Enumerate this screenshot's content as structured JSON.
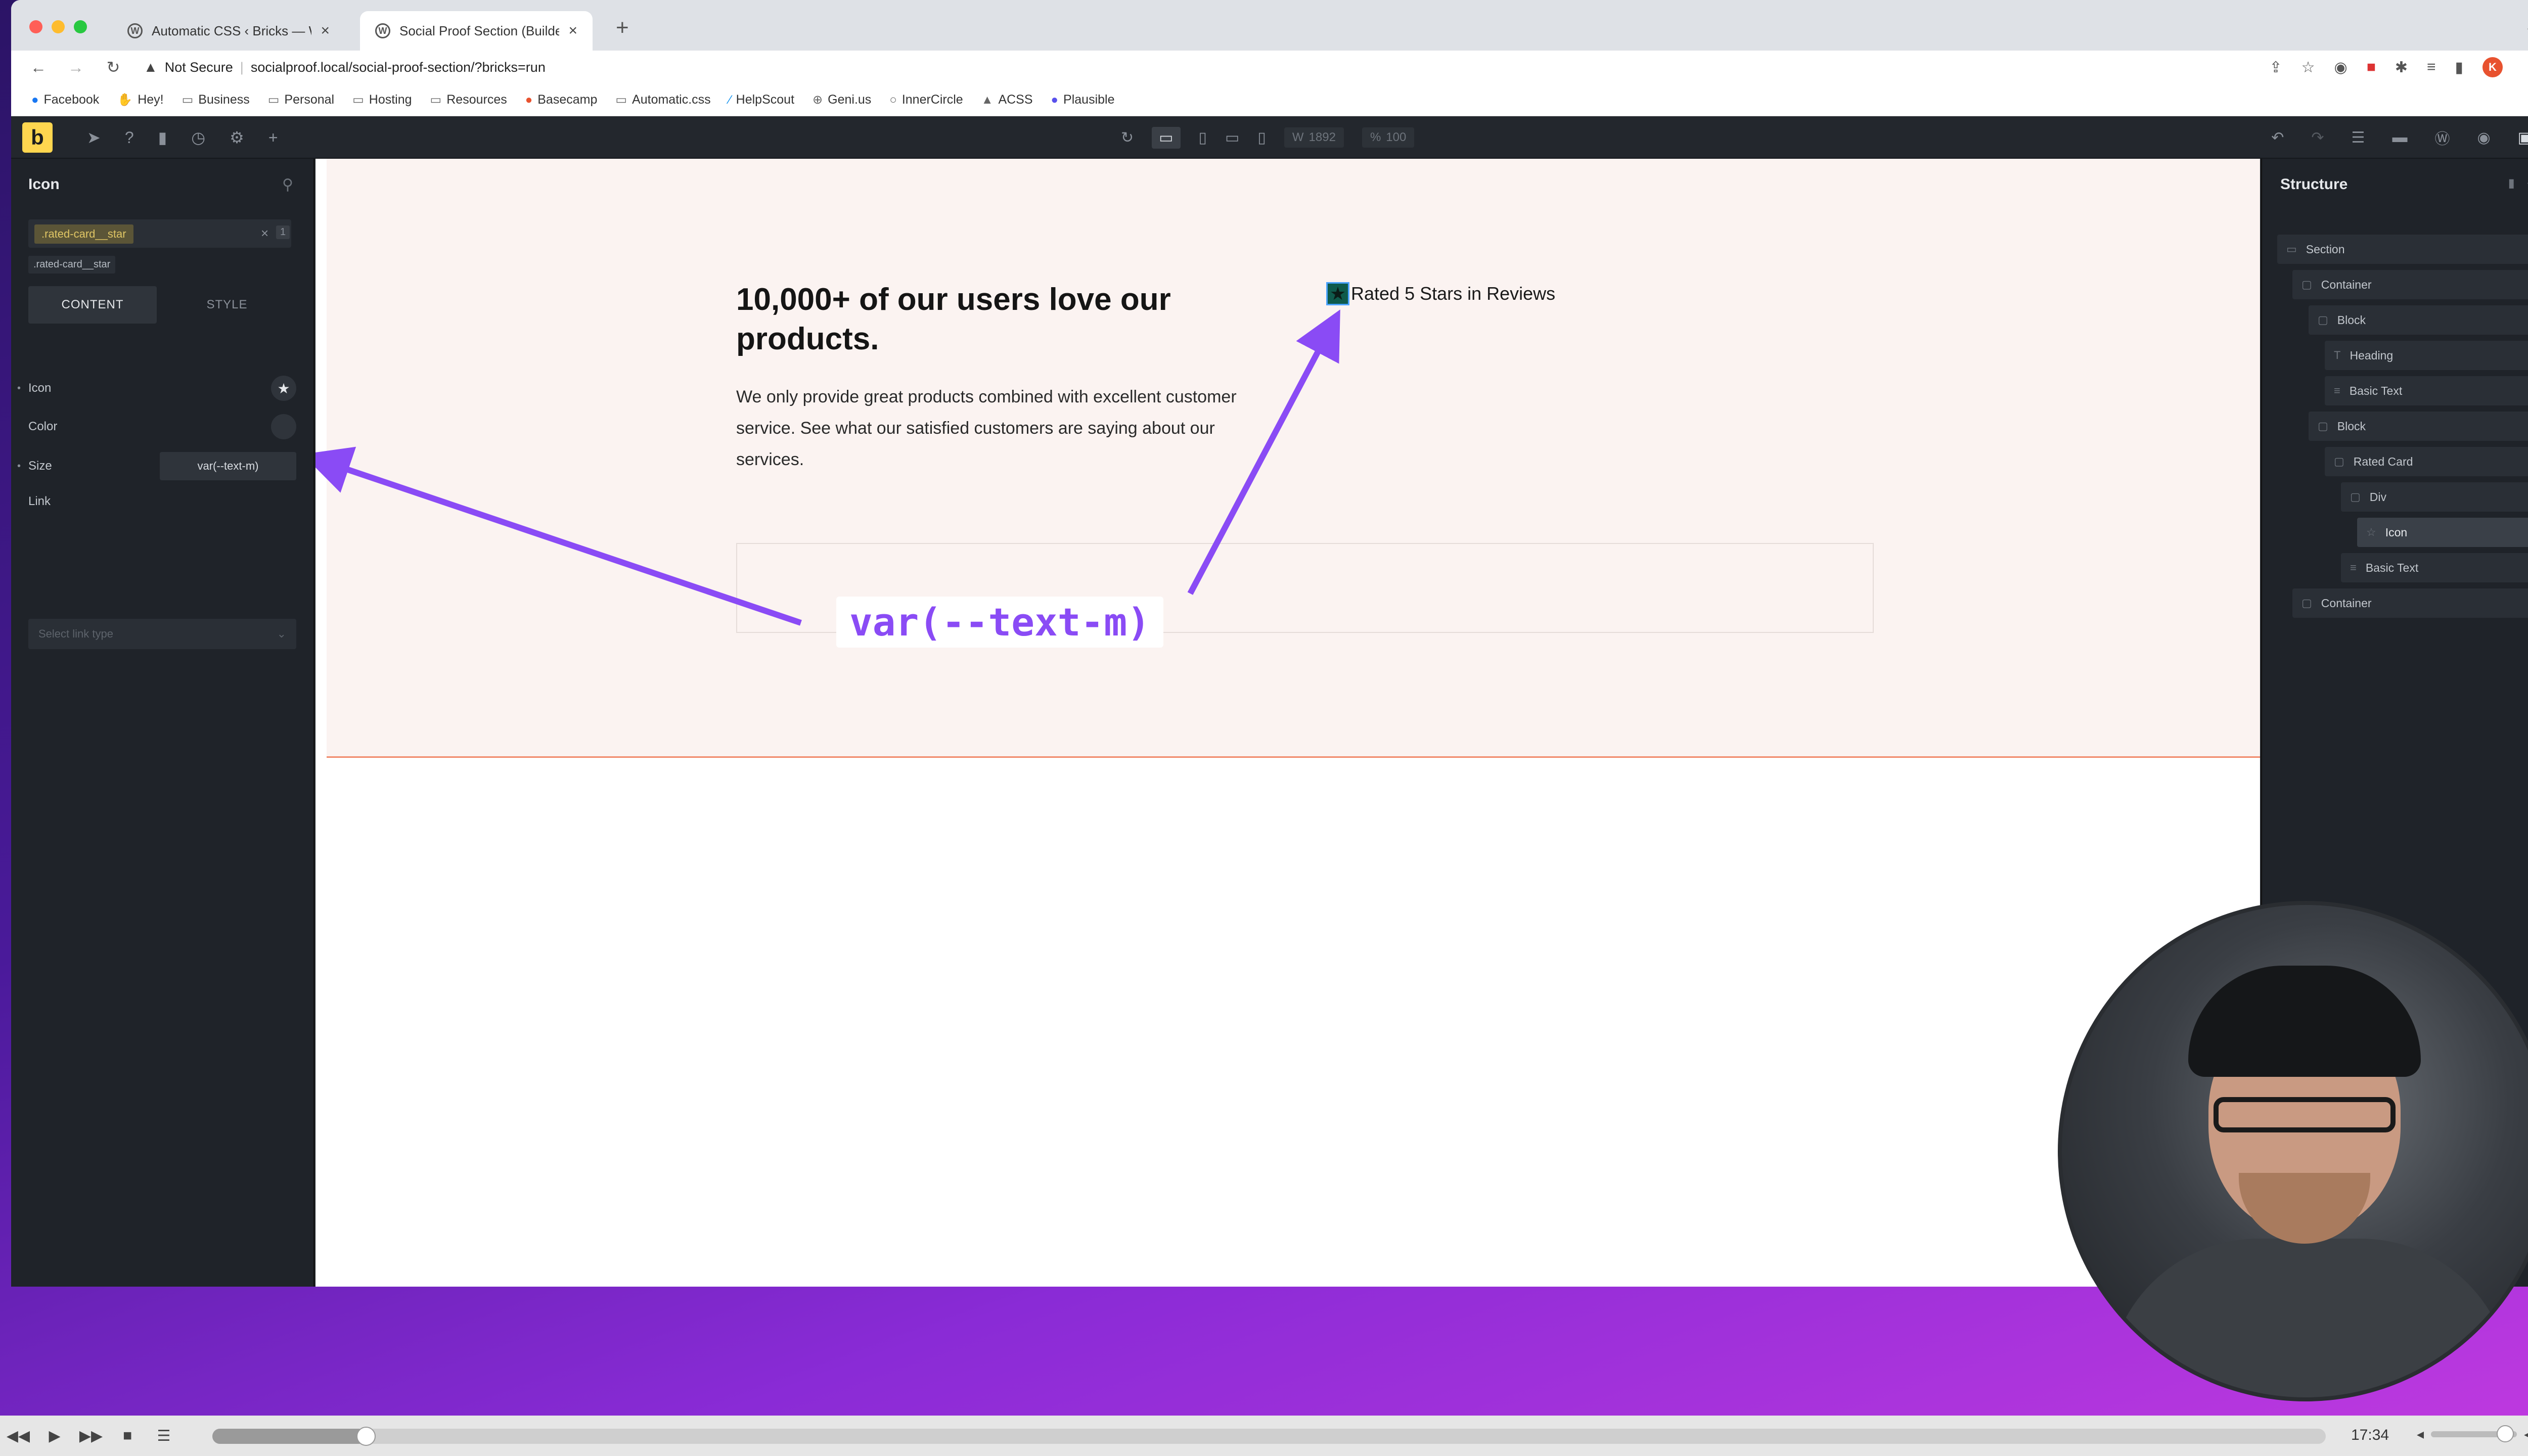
{
  "browser": {
    "tabs": [
      {
        "label": "Automatic CSS ‹ Bricks — Wor",
        "active": false
      },
      {
        "label": "Social Proof Section (Builder)",
        "active": true
      }
    ],
    "security": "Not Secure",
    "url": "socialproof.local/social-proof-section/?bricks=run",
    "profile_initial": "K",
    "bookmarks": [
      "Facebook",
      "Hey!",
      "Business",
      "Personal",
      "Hosting",
      "Resources",
      "Basecamp",
      "Automatic.css",
      "HelpScout",
      "Geni.us",
      "InnerCircle",
      "ACSS",
      "Plausible"
    ]
  },
  "builder": {
    "logo": "b",
    "width_label": "W",
    "width_value": "1892",
    "zoom_label": "%",
    "zoom_value": "100"
  },
  "left_panel": {
    "title": "Icon",
    "class_chip": ".rated-card__star",
    "class_count": "1",
    "class_tag": ".rated-card__star",
    "tabs": [
      "CONTENT",
      "STYLE"
    ],
    "controls": {
      "icon_label": "Icon",
      "color_label": "Color",
      "size_label": "Size",
      "size_value": "var(--text-m)",
      "link_label": "Link",
      "link_placeholder": "Select link type"
    }
  },
  "canvas": {
    "heading": "10,000+ of our users love our products.",
    "body": "We only provide great products combined with excellent customer service. See what our satisfied customers are saying about our services.",
    "rated_text": "Rated 5 Stars in Reviews",
    "callout": "var(--text-m)",
    "accent_color": "#8a4bf5"
  },
  "structure": {
    "title": "Structure",
    "nodes": [
      {
        "label": "Section",
        "depth": 0
      },
      {
        "label": "Container",
        "depth": 1
      },
      {
        "label": "Block",
        "depth": 2
      },
      {
        "label": "Heading",
        "depth": 3
      },
      {
        "label": "Basic Text",
        "depth": 3
      },
      {
        "label": "Block",
        "depth": 2
      },
      {
        "label": "Rated Card",
        "depth": 3
      },
      {
        "label": "Div",
        "depth": 4
      },
      {
        "label": "Icon",
        "depth": 5
      },
      {
        "label": "Basic Text",
        "depth": 4
      },
      {
        "label": "Container",
        "depth": 1
      }
    ]
  },
  "player": {
    "time": "17:34",
    "progress": 0.0727
  }
}
